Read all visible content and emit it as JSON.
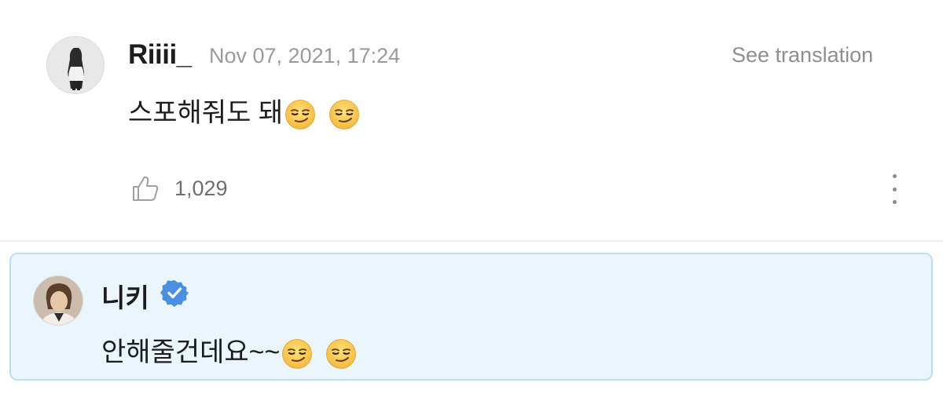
{
  "comment": {
    "username": "Riiii_",
    "timestamp": "Nov 07, 2021, 17:24",
    "translate_label": "See translation",
    "text": "스포해줘도 돼",
    "emojis": [
      "smirking-face",
      "smirking-face"
    ],
    "like_count": "1,029"
  },
  "reply": {
    "username": "니키",
    "verified": true,
    "text": "안해줄건데요~~",
    "emojis": [
      "smirking-face",
      "smirking-face"
    ]
  },
  "colors": {
    "reply_bg": "#eaf6fc",
    "reply_border": "#b8e0f2",
    "verified_blue": "#4a90e2",
    "emoji_yellow": "#fdd04d"
  }
}
